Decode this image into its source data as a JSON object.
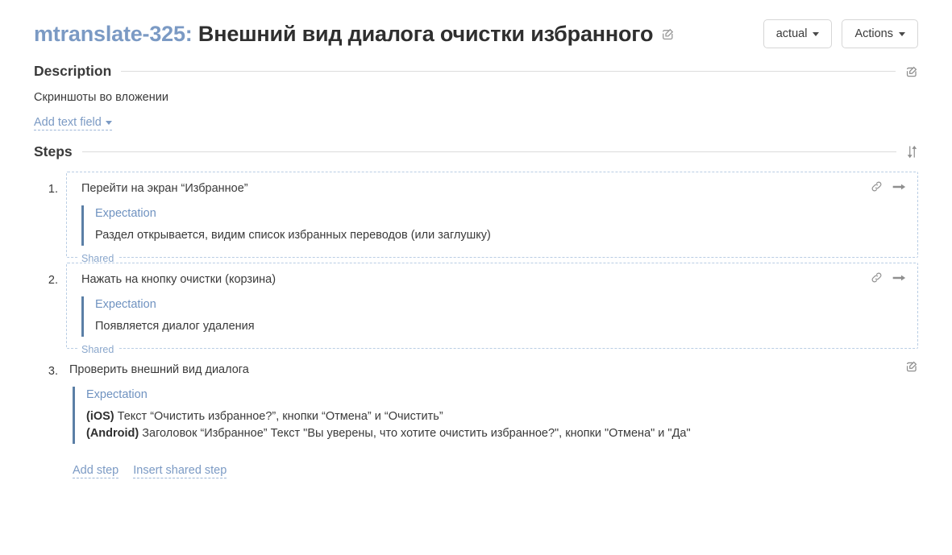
{
  "header": {
    "issue_key": "mtranslate-325:",
    "issue_title": "Внешний вид диалога очистки избранного",
    "edit_icon": "edit-square-icon",
    "status_button": "actual",
    "actions_button": "Actions"
  },
  "description": {
    "section_title": "Description",
    "edit_icon": "edit-square-icon",
    "body": "Скриншоты во вложении",
    "add_text_field_link": "Add text field"
  },
  "steps_section": {
    "section_title": "Steps",
    "sort_icon": "sort-arrows-icon",
    "steps": [
      {
        "number": "1.",
        "action": "Перейти на экран “Избранное”",
        "expectation_label": "Expectation",
        "expectation": "Раздел открывается, видим список избранных переводов (или заглушку)",
        "shared_tag": "Shared",
        "shared": true,
        "icons": [
          "link-icon",
          "arrow-right-icon"
        ]
      },
      {
        "number": "2.",
        "action": "Нажать на кнопку очистки (корзина)",
        "expectation_label": "Expectation",
        "expectation": "Появляется диалог удаления",
        "shared_tag": "Shared",
        "shared": true,
        "icons": [
          "link-icon",
          "arrow-right-icon"
        ]
      },
      {
        "number": "3.",
        "action": "Проверить внешний вид диалога",
        "expectation_label": "Expectation",
        "expectation_lines": [
          {
            "bold": "(iOS)",
            "rest": " Текст “Очистить избранное?”, кнопки “Отмена” и “Очистить”"
          },
          {
            "bold": "(Android)",
            "rest": " Заголовок “Избранное” Текст \"Вы уверены, что хотите очистить избранное?\", кнопки \"Отмена\" и \"Да\""
          }
        ],
        "shared": false,
        "icons": [
          "edit-square-icon"
        ]
      }
    ],
    "add_step_link": "Add step",
    "insert_shared_step_link": "Insert shared step"
  },
  "colors": {
    "link_blue": "#7b9ac4",
    "expectation_blue": "#6f92c0",
    "expectation_bar": "#5b7fa6",
    "dashed_border": "#b9cde4",
    "text": "#3a3a3a",
    "rule": "#dcdcdc",
    "button_border": "#d6d6d6"
  }
}
